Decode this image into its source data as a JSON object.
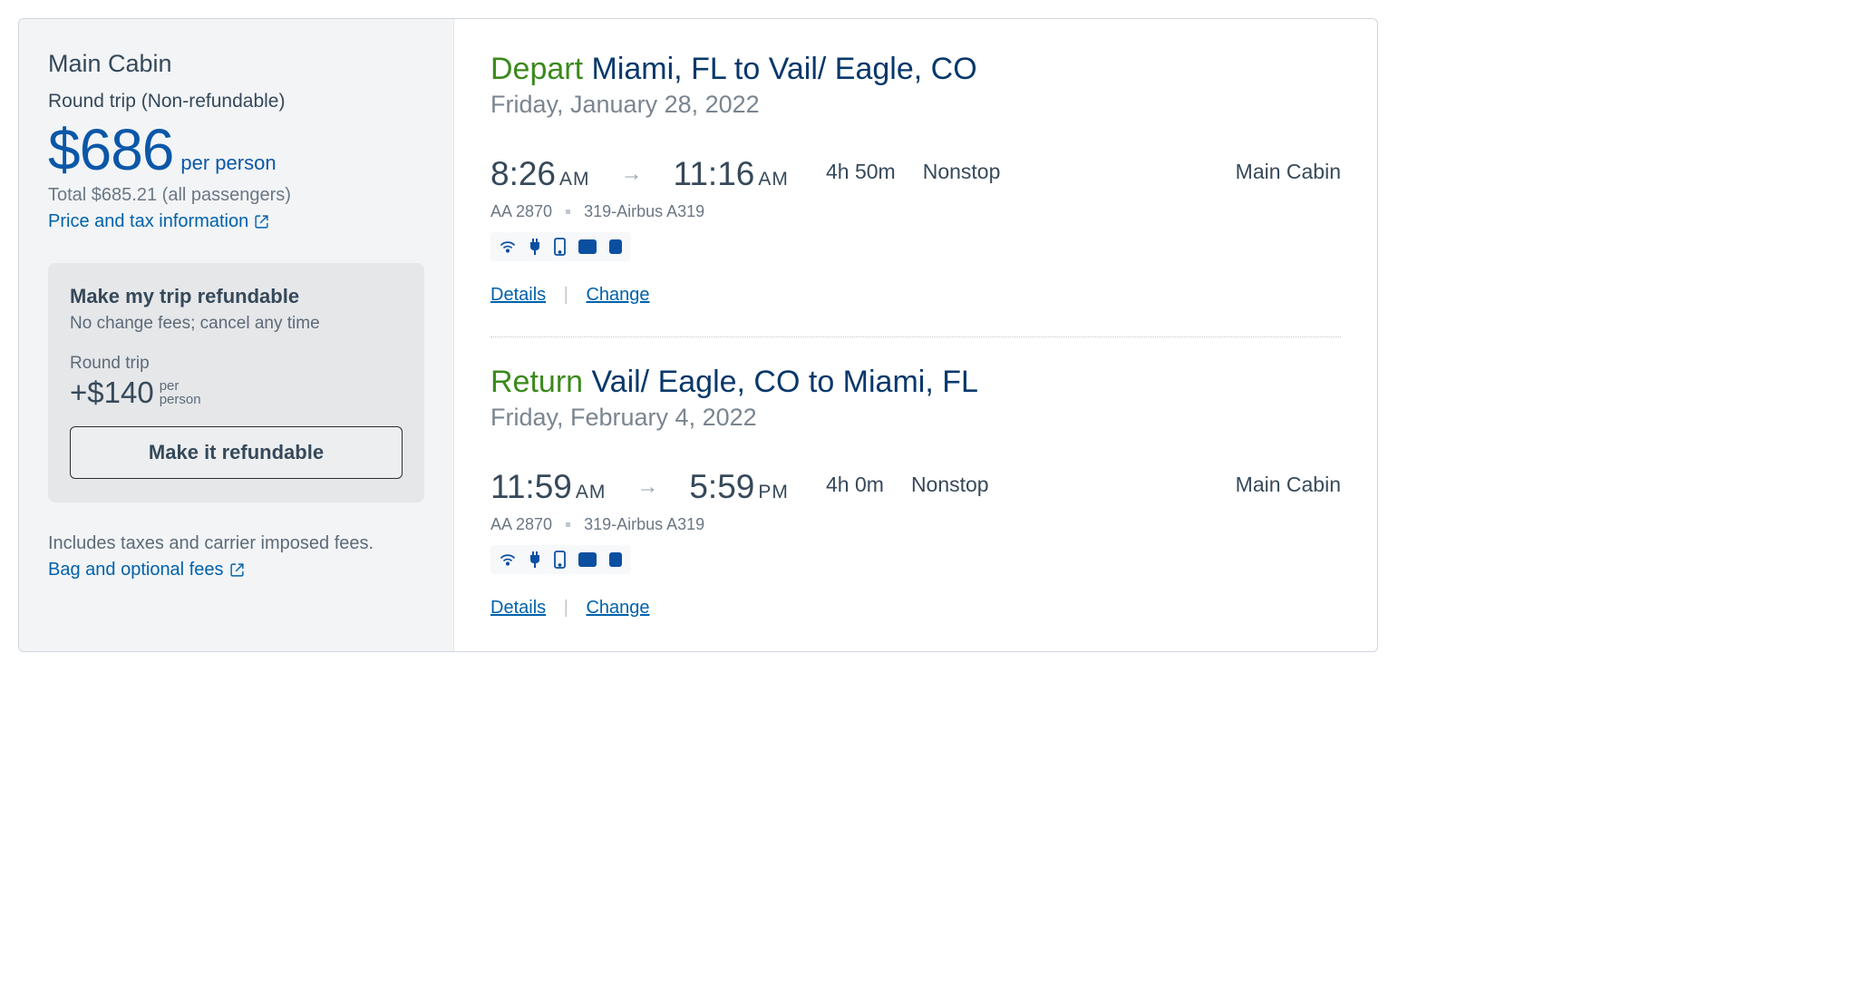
{
  "sidebar": {
    "cabin_title": "Main Cabin",
    "trip_type": "Round trip (Non-refundable)",
    "price_display": "$686",
    "per_person_label": "per person",
    "total_label": "Total $685.21 (all passengers)",
    "price_tax_link": "Price and tax information",
    "includes_label": "Includes taxes and carrier imposed fees.",
    "bag_link": "Bag and optional fees"
  },
  "refund": {
    "title": "Make my trip refundable",
    "sub": "No change fees; cancel any time",
    "rt_label": "Round trip",
    "price": "+$140",
    "per1": "per",
    "per2": "person",
    "button": "Make it refundable"
  },
  "depart": {
    "tag": "Depart",
    "route": " Miami, FL to Vail/ Eagle, CO",
    "date": "Friday, January 28, 2022",
    "dep_time": "8:26",
    "dep_mer": "AM",
    "arr_time": "11:16",
    "arr_mer": "AM",
    "duration": "4h  50m",
    "stops": "Nonstop",
    "cabin": "Main Cabin",
    "flight_no": "AA 2870",
    "aircraft": "319-Airbus A319",
    "details": "Details",
    "change": "Change"
  },
  "return": {
    "tag": "Return",
    "route": " Vail/ Eagle, CO to Miami, FL",
    "date": "Friday, February 4, 2022",
    "dep_time": "11:59",
    "dep_mer": "AM",
    "arr_time": "5:59",
    "arr_mer": "PM",
    "duration": "4h  0m",
    "stops": "Nonstop",
    "cabin": "Main Cabin",
    "flight_no": "AA 2870",
    "aircraft": "319-Airbus A319",
    "details": "Details",
    "change": "Change"
  }
}
